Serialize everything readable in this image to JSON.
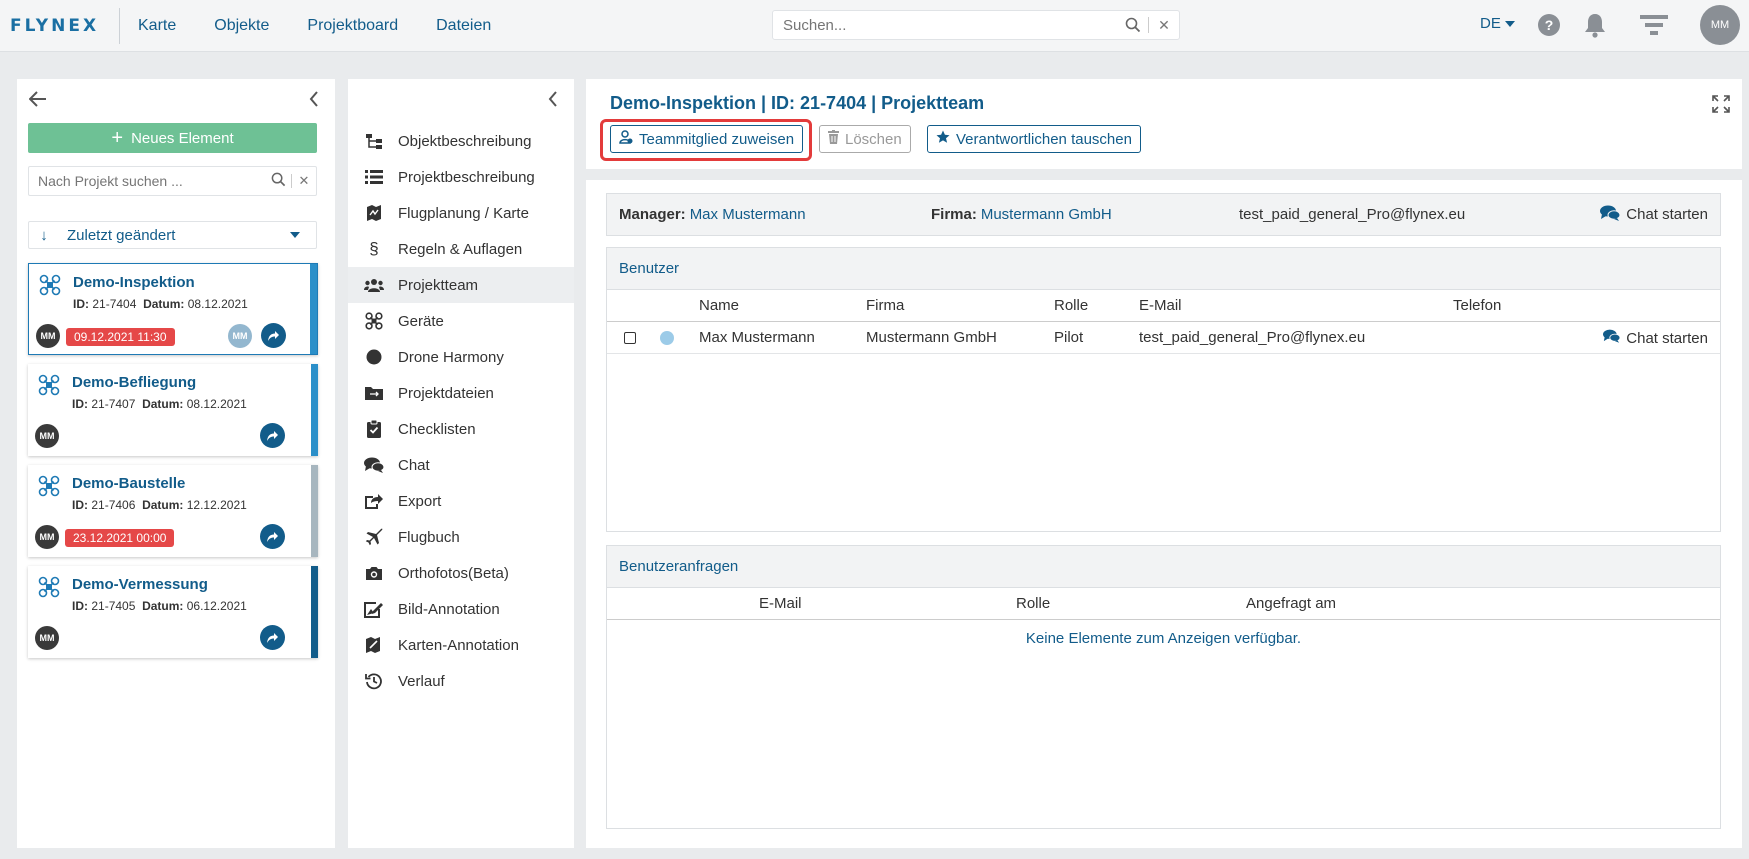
{
  "brand": {
    "logo_text": "FLYNEX"
  },
  "topnav": {
    "links": [
      "Karte",
      "Objekte",
      "Projektboard",
      "Dateien"
    ],
    "search_placeholder": "Suchen...",
    "language": "DE",
    "help": "?",
    "user_initials": "MM"
  },
  "left": {
    "new_button": "Neues Element",
    "search_placeholder": "Nach Projekt suchen ...",
    "sort_label": "Zuletzt geändert",
    "id_label": "ID:",
    "date_label": "Datum:",
    "projects": [
      {
        "title": "Demo-Inspektion",
        "id": "21-7404",
        "date": "08.12.2021",
        "owner": "MM",
        "deadline": "09.12.2021 11:30",
        "assignee": "MM",
        "stripe_color": "#2b8fc9"
      },
      {
        "title": "Demo-Befliegung",
        "id": "21-7407",
        "date": "08.12.2021",
        "owner": "MM",
        "deadline": "",
        "assignee": "",
        "stripe_color": "#2b8fc9"
      },
      {
        "title": "Demo-Baustelle",
        "id": "21-7406",
        "date": "12.12.2021",
        "owner": "MM",
        "deadline": "23.12.2021 00:00",
        "assignee": "",
        "stripe_color": "#a7b6bf"
      },
      {
        "title": "Demo-Vermessung",
        "id": "21-7405",
        "date": "06.12.2021",
        "owner": "MM",
        "deadline": "",
        "assignee": "",
        "stripe_color": "#125c8a"
      }
    ]
  },
  "menu": {
    "items": [
      {
        "label": "Objektbeschreibung",
        "icon": "sitemap-icon"
      },
      {
        "label": "Projektbeschreibung",
        "icon": "list-icon"
      },
      {
        "label": "Flugplanung / Karte",
        "icon": "map-icon"
      },
      {
        "label": "Regeln & Auflagen",
        "icon": "paragraph-icon"
      },
      {
        "label": "Projektteam",
        "icon": "users-icon",
        "active": true
      },
      {
        "label": "Geräte",
        "icon": "drone-icon"
      },
      {
        "label": "Drone Harmony",
        "icon": "circle-icon"
      },
      {
        "label": "Projektdateien",
        "icon": "folder-icon"
      },
      {
        "label": "Checklisten",
        "icon": "clipboard-check-icon"
      },
      {
        "label": "Chat",
        "icon": "comments-icon"
      },
      {
        "label": "Export",
        "icon": "export-icon"
      },
      {
        "label": "Flugbuch",
        "icon": "plane-icon"
      },
      {
        "label": "Orthofotos(Beta)",
        "icon": "camera-icon"
      },
      {
        "label": "Bild-Annotation",
        "icon": "image-edit-icon"
      },
      {
        "label": "Karten-Annotation",
        "icon": "map-edit-icon"
      },
      {
        "label": "Verlauf",
        "icon": "history-icon"
      }
    ]
  },
  "main": {
    "title": "Demo-Inspektion | ID: 21-7404 | Projektteam",
    "buttons": {
      "assign": "Teammitglied zuweisen",
      "delete": "Löschen",
      "swap": "Verantwortlichen tauschen"
    },
    "info": {
      "manager_label": "Manager:",
      "manager": "Max Mustermann",
      "company_label": "Firma:",
      "company": "Mustermann GmbH",
      "email": "test_paid_general_Pro@flynex.eu",
      "chat": "Chat starten"
    },
    "users": {
      "heading": "Benutzer",
      "columns": [
        "Name",
        "Firma",
        "Rolle",
        "E-Mail",
        "Telefon"
      ],
      "rows": [
        {
          "name": "Max Mustermann",
          "company": "Mustermann GmbH",
          "role": "Pilot",
          "email": "test_paid_general_Pro@flynex.eu",
          "phone": "",
          "chat": "Chat starten"
        }
      ]
    },
    "requests": {
      "heading": "Benutzeranfragen",
      "columns": [
        "E-Mail",
        "Rolle",
        "Angefragt am"
      ],
      "empty": "Keine Elemente zum Anzeigen verfügbar."
    }
  },
  "colors": {
    "primary": "#125c8a",
    "green": "#6ec195",
    "danger": "#e54848",
    "highlight": "#e33b3b"
  }
}
